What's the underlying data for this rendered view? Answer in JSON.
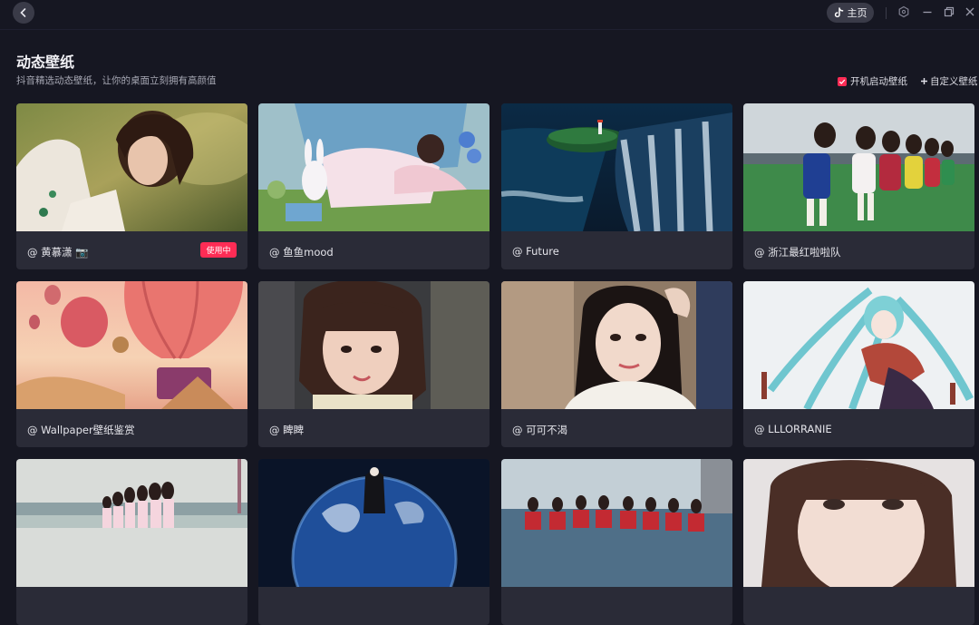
{
  "titlebar": {
    "home_label": "主页"
  },
  "header": {
    "title": "动态壁纸",
    "subtitle": "抖音精选动态壁纸，让你的桌面立刻拥有高颜值",
    "startup_label": "开机启动壁纸",
    "startup_checked": true,
    "custom_label": "自定义壁纸"
  },
  "colors": {
    "accent": "#fe2c55",
    "background": "#161722",
    "card": "#2a2b37"
  },
  "wallpapers": [
    {
      "author": "@ 黄慕潇 📷",
      "badge": "使用中"
    },
    {
      "author": "@ 鱼鱼mood",
      "badge": ""
    },
    {
      "author": "@ Future",
      "badge": ""
    },
    {
      "author": "@ 浙江最红啦啦队",
      "badge": ""
    },
    {
      "author": "@ Wallpaper壁纸鉴赏",
      "badge": ""
    },
    {
      "author": "@ 睥睥",
      "badge": ""
    },
    {
      "author": "@ 可可不渴",
      "badge": ""
    },
    {
      "author": "@ LLLORRANIE",
      "badge": ""
    },
    {
      "author": "",
      "badge": ""
    },
    {
      "author": "",
      "badge": ""
    },
    {
      "author": "",
      "badge": ""
    },
    {
      "author": "",
      "badge": ""
    }
  ]
}
